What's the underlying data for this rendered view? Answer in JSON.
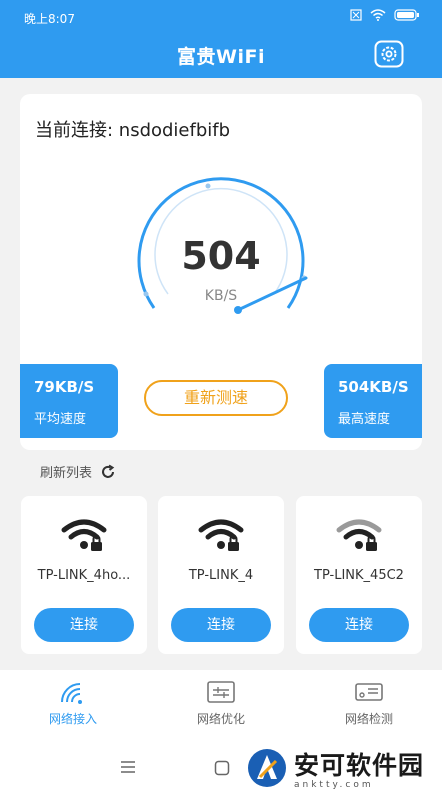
{
  "status": {
    "time": "晚上8:07"
  },
  "header": {
    "title": "富贵WiFi"
  },
  "connection": {
    "label": "当前连接: nsdodiefbifb"
  },
  "gauge": {
    "speed": "504",
    "unit": "KB/S"
  },
  "stats": {
    "avg_value": "79KB/S",
    "avg_label": "平均速度",
    "max_value": "504KB/S",
    "max_label": "最高速度"
  },
  "retest_label": "重新测速",
  "refresh_label": "刷新列表",
  "networks": [
    {
      "ssid": "TP-LINK_4ho...",
      "button": "连接"
    },
    {
      "ssid": "TP-LINK_4",
      "button": "连接"
    },
    {
      "ssid": "TP-LINK_45C2",
      "button": "连接"
    }
  ],
  "nav": [
    {
      "label": "网络接入"
    },
    {
      "label": "网络优化"
    },
    {
      "label": "网络检测"
    }
  ],
  "watermark": {
    "title": "安可软件园",
    "sub": "anktty.com"
  },
  "colors": {
    "accent": "#2f9bf0",
    "button_outline": "#f0a21b"
  }
}
